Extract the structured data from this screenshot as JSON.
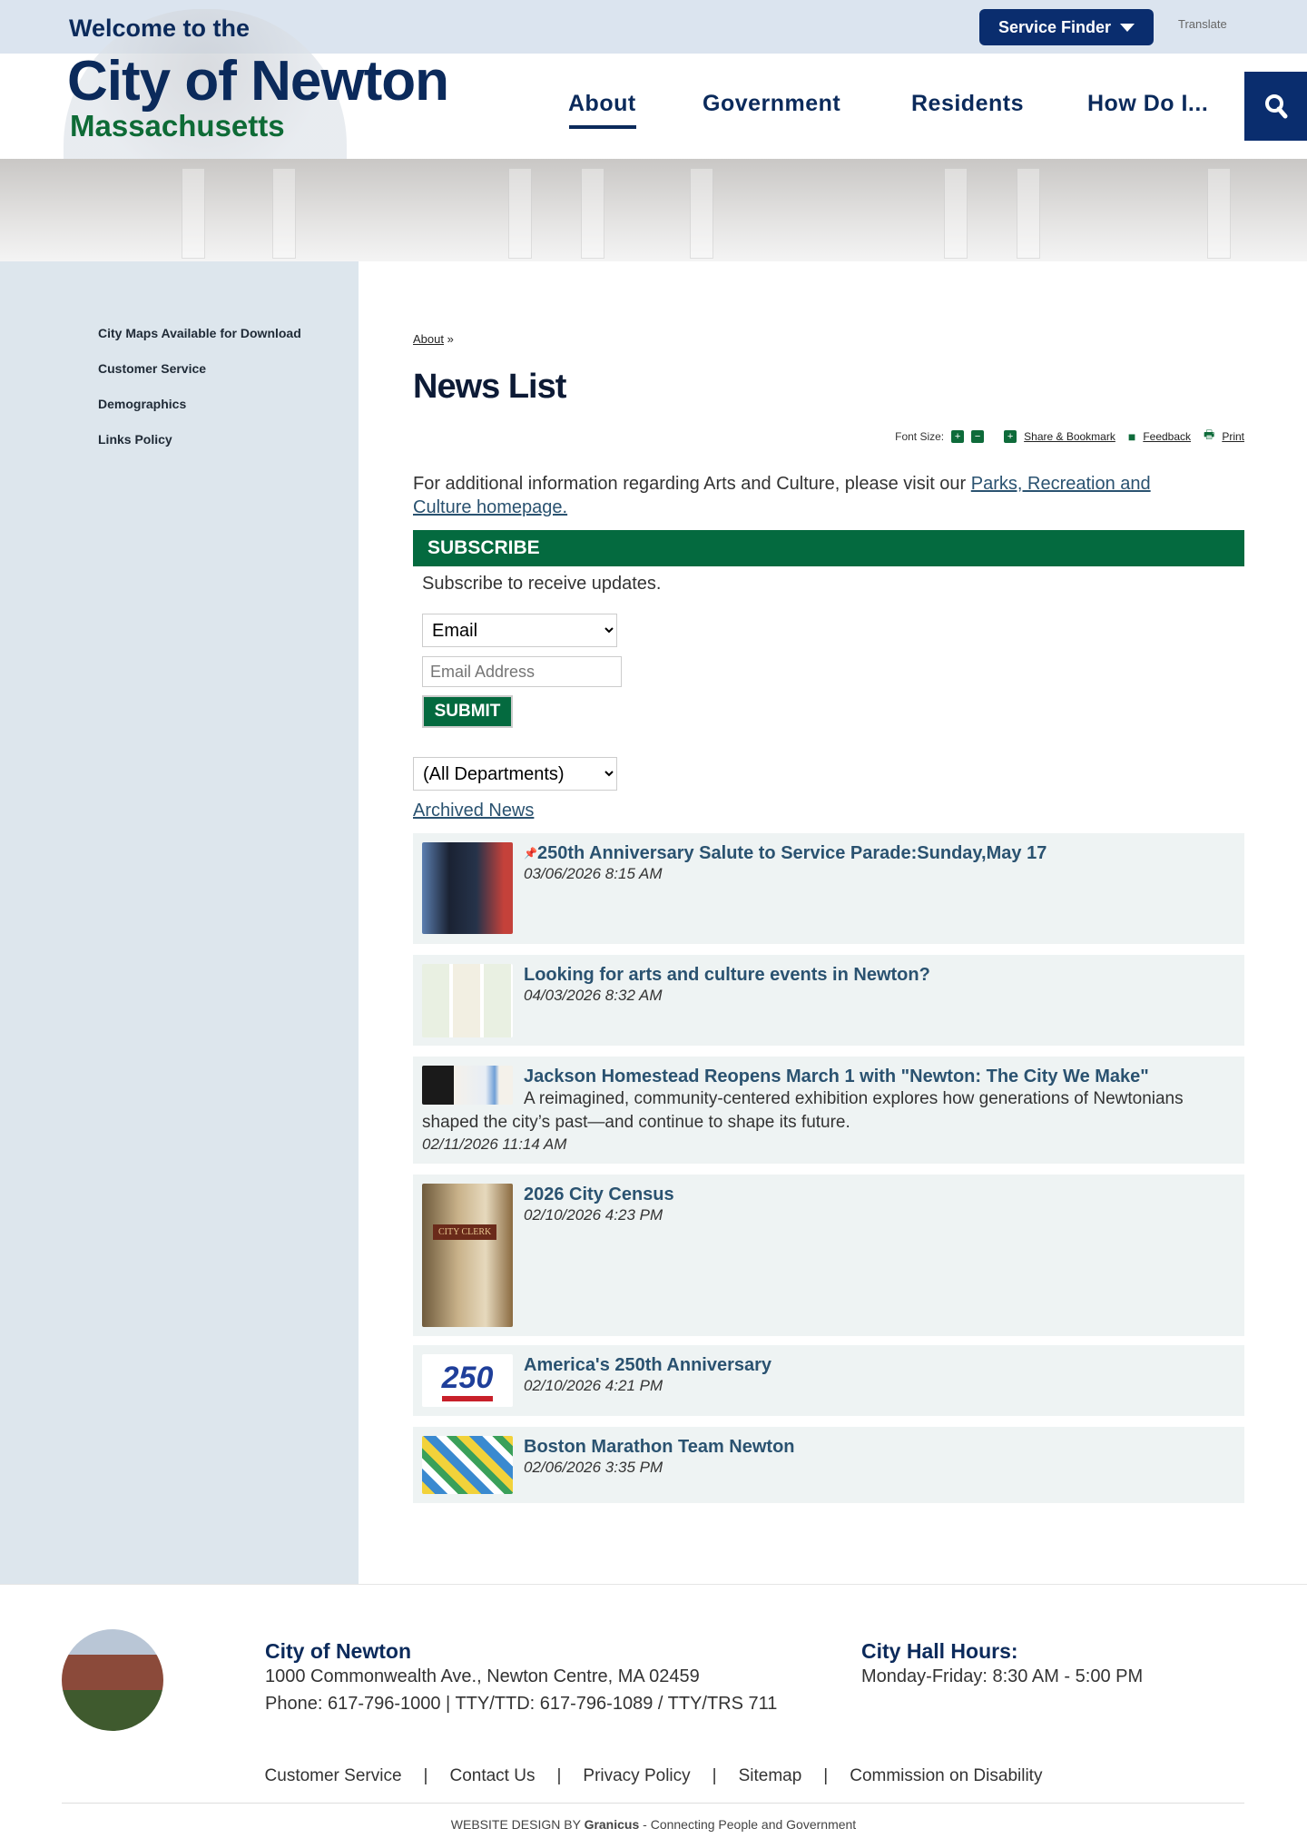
{
  "header": {
    "welcome": "Welcome to the",
    "city": "City of Newton",
    "state": "Massachusetts",
    "service_finder": "Service Finder",
    "translate": "Translate",
    "nav": [
      "About",
      "Government",
      "Residents",
      "How Do I..."
    ]
  },
  "sidebar": {
    "items": [
      "City Maps Available for Download",
      "Customer Service",
      "Demographics",
      "Links Policy"
    ]
  },
  "breadcrumb": {
    "link": "About",
    "sep": "»"
  },
  "page_title": "News List",
  "tools": {
    "font_size": "Font Size:",
    "plus": "+",
    "minus": "−",
    "share": "Share & Bookmark",
    "feedback": "Feedback",
    "print": "Print"
  },
  "intro": {
    "text": "For additional information regarding Arts and Culture, please visit our ",
    "link": "Parks, Recreation and Culture homepage."
  },
  "subscribe": {
    "heading": "SUBSCRIBE",
    "text": "Subscribe to receive updates.",
    "type_value": "Email",
    "email_placeholder": "Email Address",
    "submit": "SUBMIT"
  },
  "filter": {
    "department": "(All Departments)"
  },
  "archived": "Archived News",
  "news": [
    {
      "title": "250th Anniversary Salute to Service Parade:Sunday,May 17",
      "date": "03/06/2026 8:15 AM",
      "pinned": true
    },
    {
      "title": "Looking for arts and culture events in Newton?",
      "date": "04/03/2026 8:32 AM"
    },
    {
      "title": "Jackson Homestead Reopens March 1 with \"Newton: The City We Make\"",
      "desc": "A reimagined, community-centered exhibition explores how generations of Newtonians shaped the city’s past—and continue to shape its future.",
      "date": "02/11/2026 11:14 AM"
    },
    {
      "title": "2026 City Census",
      "date": "02/10/2026 4:23 PM",
      "thumb_text": "CITY CLERK"
    },
    {
      "title": "America's 250th Anniversary",
      "date": "02/10/2026 4:21 PM",
      "thumb_text": "250"
    },
    {
      "title": "Boston Marathon Team Newton",
      "date": "02/06/2026 3:35 PM"
    }
  ],
  "footer": {
    "name": "City of Newton",
    "address": "1000 Commonwealth Ave., Newton Centre, MA 02459",
    "phone": "Phone: 617-796-1000 | TTY/TTD: 617-796-1089 / TTY/TRS 711",
    "hours_title": "City Hall Hours:",
    "hours": "Monday-Friday: 8:30 AM - 5:00 PM",
    "links": [
      "Customer Service",
      "Contact Us",
      "Privacy Policy",
      "Sitemap",
      "Commission on Disability"
    ],
    "sep": "|",
    "credit_prefix": "WEBSITE DESIGN BY ",
    "credit_brand": "Granicus",
    "credit_suffix": " - Connecting People and Government"
  },
  "colors": {
    "navy": "#0b2a5b",
    "green": "#046a3f",
    "link": "#2a5270",
    "sidebar": "#dde6ed"
  }
}
